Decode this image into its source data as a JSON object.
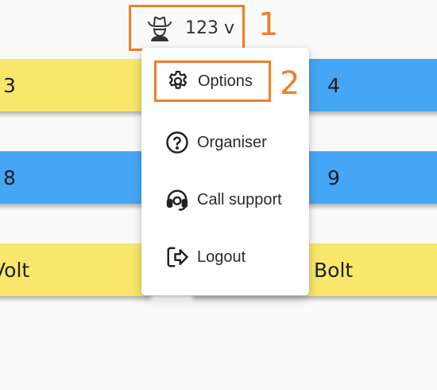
{
  "user": {
    "name": "123 v",
    "icon": "cowboy-avatar-icon"
  },
  "tiles": [
    {
      "label": "3",
      "color": "#f8e76b"
    },
    {
      "label": "4",
      "color": "#45a6f5"
    },
    {
      "label": "8",
      "color": "#45a6f5"
    },
    {
      "label": "9",
      "color": "#45a6f5"
    },
    {
      "label": "Volt",
      "color": "#f8e76b"
    },
    {
      "label": "Bolt",
      "color": "#f8e76b"
    }
  ],
  "menu": {
    "items": [
      {
        "label": "Options",
        "icon": "gear-icon"
      },
      {
        "label": "Organiser",
        "icon": "question-circle-icon"
      },
      {
        "label": "Call support",
        "icon": "headset-icon"
      },
      {
        "label": "Logout",
        "icon": "logout-icon"
      }
    ]
  },
  "annotations": {
    "one": "1",
    "two": "2",
    "color": "#f07f28"
  }
}
